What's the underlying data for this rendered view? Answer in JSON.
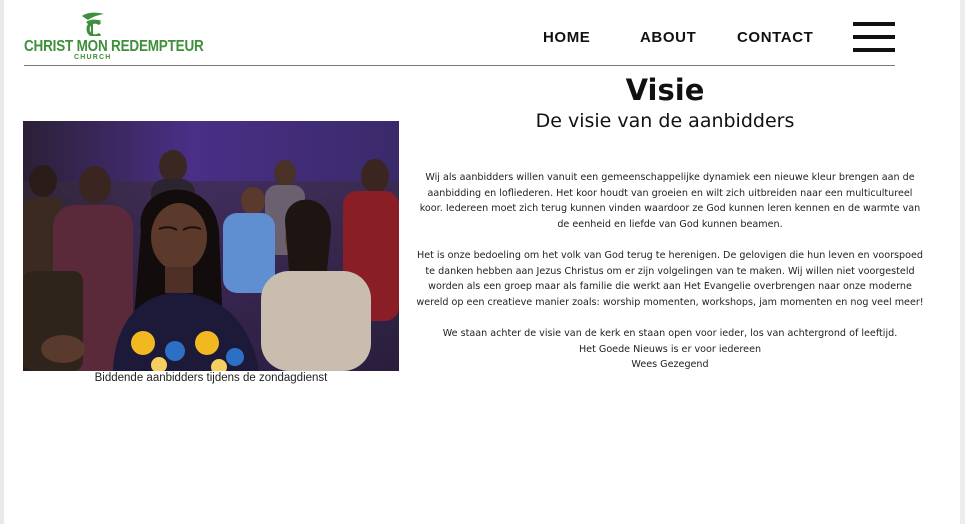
{
  "header": {
    "logo": {
      "name": "CHRIST MON REDEMPTEUR",
      "sub": "CHURCH"
    },
    "nav": [
      {
        "label": "HOME"
      },
      {
        "label": "ABOUT"
      },
      {
        "label": "CONTACT"
      }
    ],
    "menu_icon": "hamburger-icon"
  },
  "main": {
    "title": "Visie",
    "subtitle": "De visie van de aanbidders",
    "image_caption": "Biddende aanbidders tijdens de zondagdienst",
    "paragraphs": [
      "Wij als aanbidders willen vanuit een gemeenschappelijke dynamiek een nieuwe kleur brengen aan de aanbidding en lofliederen. Het koor houdt van groeien en wilt zich uitbreiden naar een multicultureel koor. Iedereen moet zich terug kunnen vinden waardoor ze God kunnen leren kennen en de warmte van de eenheid en liefde van God kunnen beamen.",
      "Het is onze bedoeling om het volk van God terug te herenigen. De gelovigen die hun leven en voorspoed te danken hebben aan Jezus Christus om er zijn volgelingen van te maken. Wij willen niet voorgesteld worden als een groep maar als familie die werkt aan Het Evangelie overbrengen naar onze moderne wereld op een creatieve manier zoals: worship momenten, workshops, jam momenten en nog veel meer!",
      "We staan achter de visie van de kerk en staan open voor ieder, los van achtergrond of leeftijd."
    ],
    "closing": [
      "Het Goede Nieuws is er voor iedereen",
      "Wees Gezegend"
    ]
  },
  "colors": {
    "brand_green": "#3f8f3c",
    "text": "#111111",
    "photo_backdrop": "#4a2f86"
  }
}
